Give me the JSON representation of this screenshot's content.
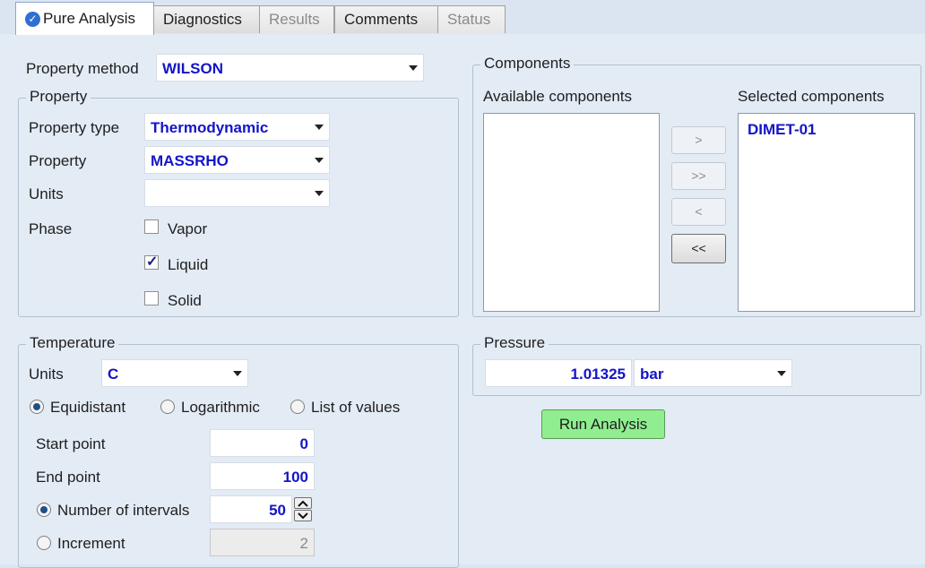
{
  "tabs": [
    {
      "label": "Pure Analysis",
      "state": "active"
    },
    {
      "label": "Diagnostics",
      "state": "enabled"
    },
    {
      "label": "Results",
      "state": "disabled"
    },
    {
      "label": "Comments",
      "state": "enabled"
    },
    {
      "label": "Status",
      "state": "disabled"
    }
  ],
  "property_method": {
    "label": "Property method",
    "value": "WILSON"
  },
  "property_group": {
    "legend": "Property",
    "type_label": "Property type",
    "type_value": "Thermodynamic",
    "property_label": "Property",
    "property_value": "MASSRHO",
    "units_label": "Units",
    "units_value": "",
    "phase_label": "Phase",
    "phases": [
      {
        "label": "Vapor",
        "checked": false
      },
      {
        "label": "Liquid",
        "checked": true
      },
      {
        "label": "Solid",
        "checked": false
      }
    ]
  },
  "components": {
    "legend": "Components",
    "available_label": "Available components",
    "selected_label": "Selected components",
    "available": [],
    "selected": [
      "DIMET-01"
    ],
    "move_buttons": [
      ">",
      ">>",
      "<",
      "<<"
    ]
  },
  "temperature": {
    "legend": "Temperature",
    "units_label": "Units",
    "units_value": "C",
    "modes": [
      {
        "label": "Equidistant",
        "selected": true
      },
      {
        "label": "Logarithmic",
        "selected": false
      },
      {
        "label": "List of values",
        "selected": false
      }
    ],
    "start_label": "Start point",
    "start_value": "0",
    "end_label": "End point",
    "end_value": "100",
    "intervals_label": "Number of intervals",
    "intervals_value": "50",
    "increment_label": "Increment",
    "increment_value": "2"
  },
  "pressure": {
    "legend": "Pressure",
    "value": "1.01325",
    "units": "bar"
  },
  "run_button": "Run Analysis",
  "colors": {
    "value_text": "#1414c8",
    "run_button": "#90ee90",
    "panel_bg": "#e3ebf5"
  }
}
